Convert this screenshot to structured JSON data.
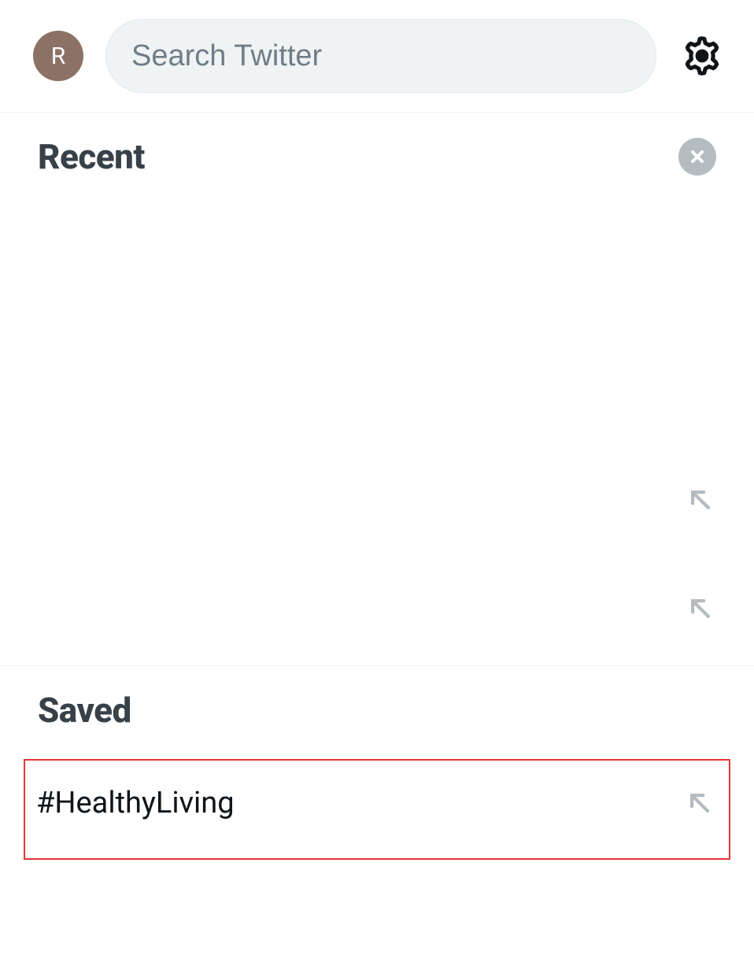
{
  "header": {
    "avatar_initial": "R",
    "search_placeholder": "Search Twitter"
  },
  "sections": {
    "recent": {
      "title": "Recent"
    },
    "saved": {
      "title": "Saved",
      "items": [
        {
          "text": "#HealthyLiving"
        }
      ]
    }
  }
}
